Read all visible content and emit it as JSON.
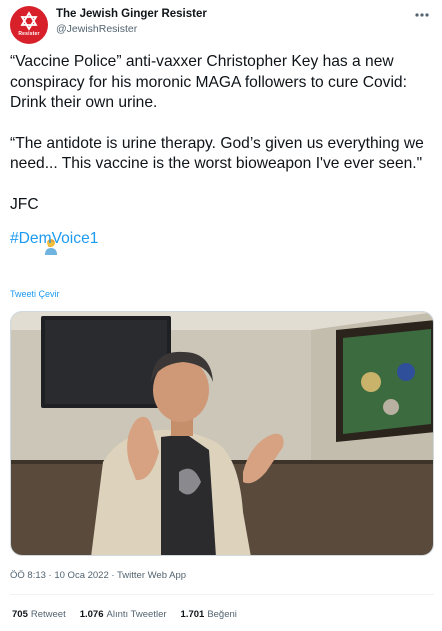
{
  "tweet": {
    "author_name": "The Jewish Ginger Resister",
    "author_handle": "@JewishResister",
    "avatar_label": "Resister",
    "paragraph_1": "“Vaccine Police” anti-vaxxer Christopher Key has a new conspiracy for his moronic MAGA followers to cure Covid: Drink their own urine.",
    "paragraph_2": "“The antidote is urine therapy. God’s given us everything we need... This vaccine is the worst bioweapon I've ever seen.\"",
    "paragraph_3": "JFC",
    "hashtag": "#DemVoice1",
    "translate_label": "Tweeti Çevir",
    "timestamp": "ÖÖ 8:13 · 10 Oca 2022 · Twitter Web App"
  },
  "stats": {
    "retweets_count": "705",
    "retweets_label": "Retweet",
    "quotes_count": "1.076",
    "quotes_label": "Alıntı Tweetler",
    "likes_count": "1.701",
    "likes_label": "Beğeni"
  },
  "icons": {
    "more": "more-dots-icon",
    "emoji": "person-facepalming-emoji",
    "avatar": "star-of-david-icon"
  },
  "colors": {
    "link": "#1d9bf0",
    "text": "#0f1419",
    "secondary": "#536471",
    "avatar_bg": "#d8202a"
  }
}
